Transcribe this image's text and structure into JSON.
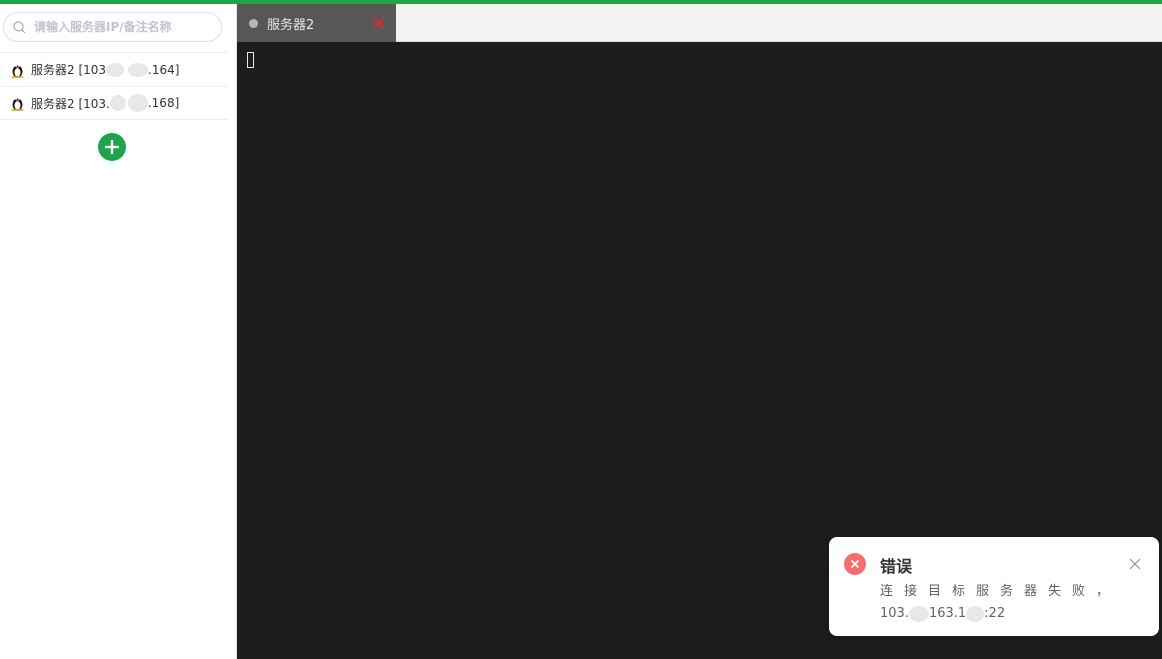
{
  "search": {
    "placeholder": "请输入服务器IP/备注名称"
  },
  "servers": [
    {
      "label_start": "服务器2 [103",
      "label_end": ".164]"
    },
    {
      "label_start": "服务器2 [103.",
      "label_end": ".168]"
    }
  ],
  "tabs": [
    {
      "label": "服务器2"
    }
  ],
  "notification": {
    "title": "错误",
    "message_line1": "连接目标服务器失败，",
    "message_ip_start": "103.",
    "message_ip_mid": "163.1",
    "message_ip_end": ":22"
  },
  "colors": {
    "accent": "#1ea54a",
    "terminal_bg": "#1d1d1d",
    "tab_bg": "#575757",
    "tab_close": "#e02a2a",
    "error": "#f56c6c"
  },
  "icons": {
    "search": "search-icon",
    "server": "linux-icon",
    "add": "plus-icon",
    "tab_status": "dot-icon",
    "tab_close": "close-icon",
    "error": "error-icon",
    "notify_close": "close-icon"
  }
}
